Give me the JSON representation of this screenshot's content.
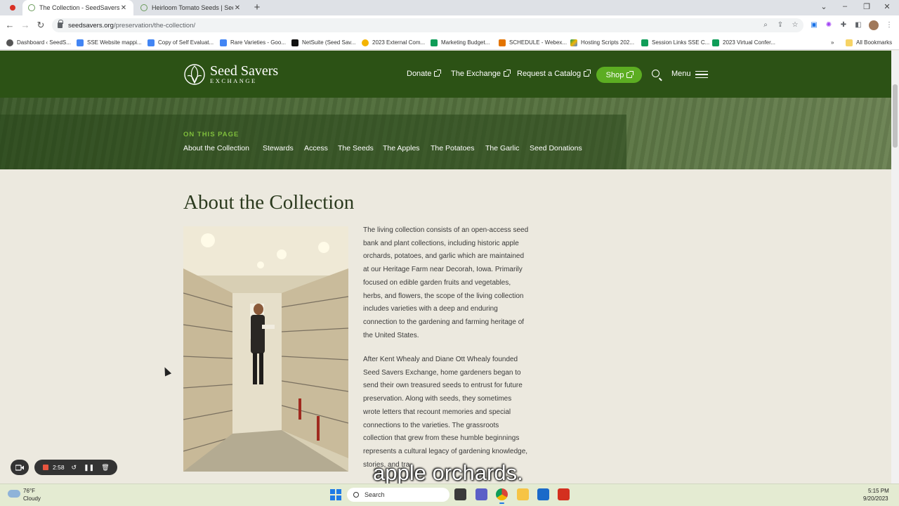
{
  "browser": {
    "tabs": [
      {
        "label": "The Collection - SeedSavers",
        "active": true
      },
      {
        "label": "Heirloom Tomato Seeds | Seed Sa",
        "active": false
      }
    ],
    "url_host": "seedsavers.org",
    "url_path": "/preservation/the-collection/",
    "bookmarks": [
      "Dashboard ‹ SeedS...",
      "SSE Website mappi...",
      "Copy of Self Evaluat...",
      "Rare Varieties - Goo...",
      "NetSuite (Seed Sav...",
      "2023 External Com...",
      "Marketing Budget...",
      "SCHEDULE - Webex...",
      "Hosting Scripts 202...",
      "Session Links SSE C...",
      "2023 Virtual Confer..."
    ],
    "all_bookmarks": "All Bookmarks"
  },
  "site": {
    "logo_title": "Seed Savers",
    "logo_sub": "EXCHANGE",
    "nav": {
      "donate": "Donate",
      "exchange": "The Exchange",
      "catalog": "Request a Catalog",
      "shop": "Shop",
      "menu": "Menu"
    },
    "on_this_page": {
      "title": "ON THIS PAGE",
      "links": [
        "About the Collection",
        "Stewards",
        "Access",
        "The Seeds",
        "The Apples",
        "The Potatoes",
        "The Garlic",
        "Seed Donations"
      ]
    }
  },
  "main": {
    "heading": "About the Collection",
    "para1": "The living collection consists of an open-access seed bank and plant collections, including historic apple orchards, potatoes, and garlic which are maintained at our Heritage Farm near Decorah, Iowa. Primarily focused on edible garden fruits and vegetables, herbs, and flowers, the scope of the living collection includes varieties with a deep and enduring connection to the gardening and farming heritage of the United States.",
    "para2": "After Kent Whealy and Diane Ott Whealy founded Seed Savers Exchange, home gardeners began to send their own treasured seeds to entrust for future preservation. Along with seeds, they sometimes wrote letters that recount memories and special connections to the varieties. The grassroots collection that grew from these humble beginnings represents a cultural legacy of gardening knowledge, stories, and tra"
  },
  "caption": "apple orchards.",
  "recorder": {
    "time": "2:58"
  },
  "taskbar": {
    "temp": "76°F",
    "condition": "Cloudy",
    "search": "Search",
    "time": "5:15 PM",
    "date": "9/20/2023"
  }
}
